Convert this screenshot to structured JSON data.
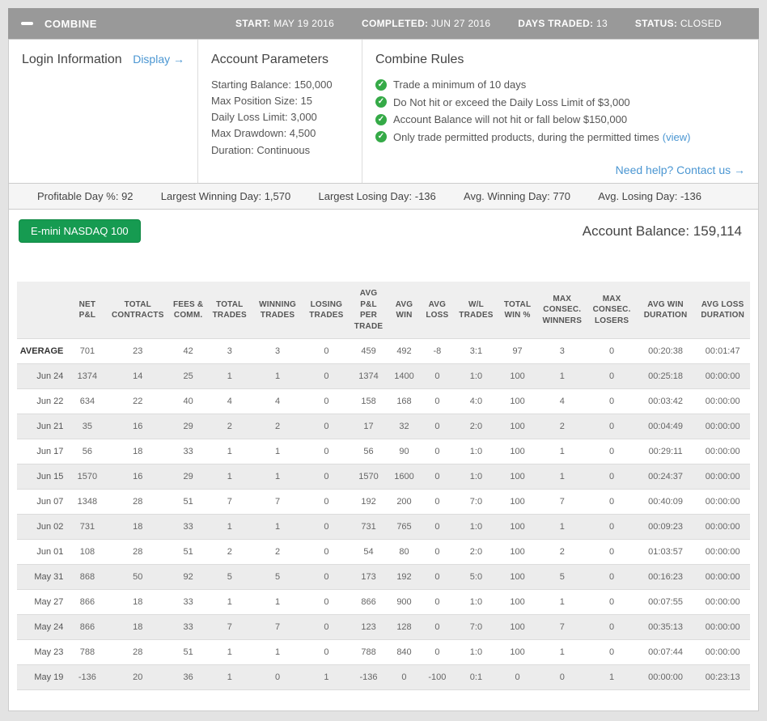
{
  "header": {
    "title": "COMBINE",
    "fields": [
      {
        "label": "START:",
        "value": "MAY 19 2016"
      },
      {
        "label": "COMPLETED:",
        "value": "JUN 27 2016"
      },
      {
        "label": "DAYS TRADED:",
        "value": "13"
      },
      {
        "label": "STATUS:",
        "value": "CLOSED"
      }
    ]
  },
  "info_panel": {
    "login": {
      "title": "Login Information",
      "display_link": "Display →"
    },
    "account_parameters": {
      "title": "Account Parameters",
      "lines": [
        "Starting Balance: 150,000",
        "Max Position Size: 15",
        "Daily Loss Limit: 3,000",
        "Max Drawdown: 4,500",
        "Duration: Continuous"
      ]
    },
    "combine_rules": {
      "title": "Combine Rules",
      "rules": [
        {
          "text": "Trade a minimum of 10 days",
          "link": ""
        },
        {
          "text": "Do Not hit or exceed the Daily Loss Limit of $3,000",
          "link": ""
        },
        {
          "text": "Account Balance will not hit or fall below $150,000",
          "link": ""
        },
        {
          "text": "Only trade permitted products, during the permitted times",
          "link": "(view)"
        }
      ]
    },
    "help_link": "Need help? Contact us →"
  },
  "stats": [
    {
      "label": "Profitable Day %:",
      "value": "92"
    },
    {
      "label": "Largest Winning Day:",
      "value": "1,570"
    },
    {
      "label": "Largest Losing Day:",
      "value": "-136"
    },
    {
      "label": "Avg. Winning Day:",
      "value": "770"
    },
    {
      "label": "Avg. Losing Day:",
      "value": "-136"
    }
  ],
  "account_section": {
    "product_button": "E-mini NASDAQ 100",
    "balance_label": "Account Balance:",
    "balance_value": "159,114"
  },
  "colors": {
    "header_gray": "#999999",
    "accent_green": "#169b51",
    "check_green": "#35aa47",
    "link_blue": "#4a96d2"
  },
  "table": {
    "columns": [
      "",
      "NET P&L",
      "TOTAL CONTRACTS",
      "FEES & COMM.",
      "TOTAL TRADES",
      "WINNING TRADES",
      "LOSING TRADES",
      "AVG P&L PER TRADE",
      "AVG WIN",
      "AVG LOSS",
      "W/L TRADES",
      "TOTAL WIN %",
      "MAX CONSEC. WINNERS",
      "MAX CONSEC. LOSERS",
      "AVG WIN DURATION",
      "AVG LOSS DURATION"
    ],
    "rows": [
      {
        "label": "AVERAGE",
        "bold": true,
        "cells": [
          "701",
          "23",
          "42",
          "3",
          "3",
          "0",
          "459",
          "492",
          "-8",
          "3:1",
          "97",
          "3",
          "0",
          "00:20:38",
          "00:01:47"
        ]
      },
      {
        "label": "Jun 24",
        "bold": false,
        "cells": [
          "1374",
          "14",
          "25",
          "1",
          "1",
          "0",
          "1374",
          "1400",
          "0",
          "1:0",
          "100",
          "1",
          "0",
          "00:25:18",
          "00:00:00"
        ]
      },
      {
        "label": "Jun 22",
        "bold": false,
        "cells": [
          "634",
          "22",
          "40",
          "4",
          "4",
          "0",
          "158",
          "168",
          "0",
          "4:0",
          "100",
          "4",
          "0",
          "00:03:42",
          "00:00:00"
        ]
      },
      {
        "label": "Jun 21",
        "bold": false,
        "cells": [
          "35",
          "16",
          "29",
          "2",
          "2",
          "0",
          "17",
          "32",
          "0",
          "2:0",
          "100",
          "2",
          "0",
          "00:04:49",
          "00:00:00"
        ]
      },
      {
        "label": "Jun 17",
        "bold": false,
        "cells": [
          "56",
          "18",
          "33",
          "1",
          "1",
          "0",
          "56",
          "90",
          "0",
          "1:0",
          "100",
          "1",
          "0",
          "00:29:11",
          "00:00:00"
        ]
      },
      {
        "label": "Jun 15",
        "bold": false,
        "cells": [
          "1570",
          "16",
          "29",
          "1",
          "1",
          "0",
          "1570",
          "1600",
          "0",
          "1:0",
          "100",
          "1",
          "0",
          "00:24:37",
          "00:00:00"
        ]
      },
      {
        "label": "Jun 07",
        "bold": false,
        "cells": [
          "1348",
          "28",
          "51",
          "7",
          "7",
          "0",
          "192",
          "200",
          "0",
          "7:0",
          "100",
          "7",
          "0",
          "00:40:09",
          "00:00:00"
        ]
      },
      {
        "label": "Jun 02",
        "bold": false,
        "cells": [
          "731",
          "18",
          "33",
          "1",
          "1",
          "0",
          "731",
          "765",
          "0",
          "1:0",
          "100",
          "1",
          "0",
          "00:09:23",
          "00:00:00"
        ]
      },
      {
        "label": "Jun 01",
        "bold": false,
        "cells": [
          "108",
          "28",
          "51",
          "2",
          "2",
          "0",
          "54",
          "80",
          "0",
          "2:0",
          "100",
          "2",
          "0",
          "01:03:57",
          "00:00:00"
        ]
      },
      {
        "label": "May 31",
        "bold": false,
        "cells": [
          "868",
          "50",
          "92",
          "5",
          "5",
          "0",
          "173",
          "192",
          "0",
          "5:0",
          "100",
          "5",
          "0",
          "00:16:23",
          "00:00:00"
        ]
      },
      {
        "label": "May 27",
        "bold": false,
        "cells": [
          "866",
          "18",
          "33",
          "1",
          "1",
          "0",
          "866",
          "900",
          "0",
          "1:0",
          "100",
          "1",
          "0",
          "00:07:55",
          "00:00:00"
        ]
      },
      {
        "label": "May 24",
        "bold": false,
        "cells": [
          "866",
          "18",
          "33",
          "7",
          "7",
          "0",
          "123",
          "128",
          "0",
          "7:0",
          "100",
          "7",
          "0",
          "00:35:13",
          "00:00:00"
        ]
      },
      {
        "label": "May 23",
        "bold": false,
        "cells": [
          "788",
          "28",
          "51",
          "1",
          "1",
          "0",
          "788",
          "840",
          "0",
          "1:0",
          "100",
          "1",
          "0",
          "00:07:44",
          "00:00:00"
        ]
      },
      {
        "label": "May 19",
        "bold": false,
        "cells": [
          "-136",
          "20",
          "36",
          "1",
          "0",
          "1",
          "-136",
          "0",
          "-100",
          "0:1",
          "0",
          "0",
          "1",
          "00:00:00",
          "00:23:13"
        ]
      }
    ]
  }
}
